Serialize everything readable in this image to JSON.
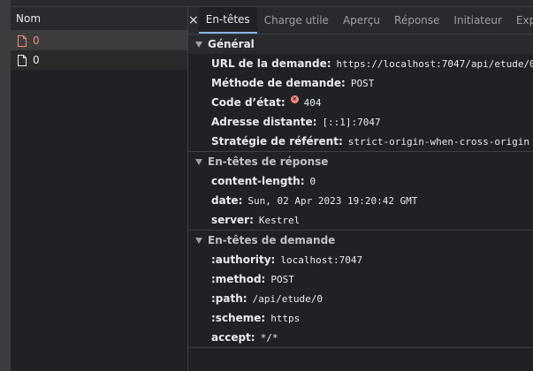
{
  "name_panel": {
    "header": "Nom",
    "requests": [
      {
        "name": "0",
        "status": "error"
      },
      {
        "name": "0",
        "status": "normal"
      }
    ]
  },
  "tabs": {
    "close_glyph": "×",
    "items": [
      "En-têtes",
      "Charge utile",
      "Aperçu",
      "Réponse",
      "Initiateur",
      "Exp"
    ],
    "active_index": 0
  },
  "general": {
    "title": "Général",
    "rows": {
      "url_key": "URL de la demande:",
      "url_val": "https://localhost:7047/api/etude/0",
      "method_key": "Méthode de demande:",
      "method_val": "POST",
      "status_key": "Code d’état:",
      "status_val": "404",
      "remote_key": "Adresse distante:",
      "remote_val": "[::1]:7047",
      "referrer_key": "Stratégie de référent:",
      "referrer_val": "strict-origin-when-cross-origin"
    }
  },
  "response_headers": {
    "title": "En-têtes de réponse",
    "rows": [
      {
        "key": "content-length:",
        "val": "0"
      },
      {
        "key": "date:",
        "val": "Sun, 02 Apr 2023 19:20:42 GMT"
      },
      {
        "key": "server:",
        "val": "Kestrel"
      }
    ]
  },
  "request_headers": {
    "title": "En-têtes de demande",
    "rows": [
      {
        "key": ":authority:",
        "val": "localhost:7047"
      },
      {
        "key": ":method:",
        "val": "POST"
      },
      {
        "key": ":path:",
        "val": "/api/etude/0"
      },
      {
        "key": ":scheme:",
        "val": "https"
      },
      {
        "key": "accept:",
        "val": "*/*"
      }
    ]
  },
  "colors": {
    "accent": "#8ab4f8",
    "error": "#f28b82",
    "background": "#202124"
  }
}
